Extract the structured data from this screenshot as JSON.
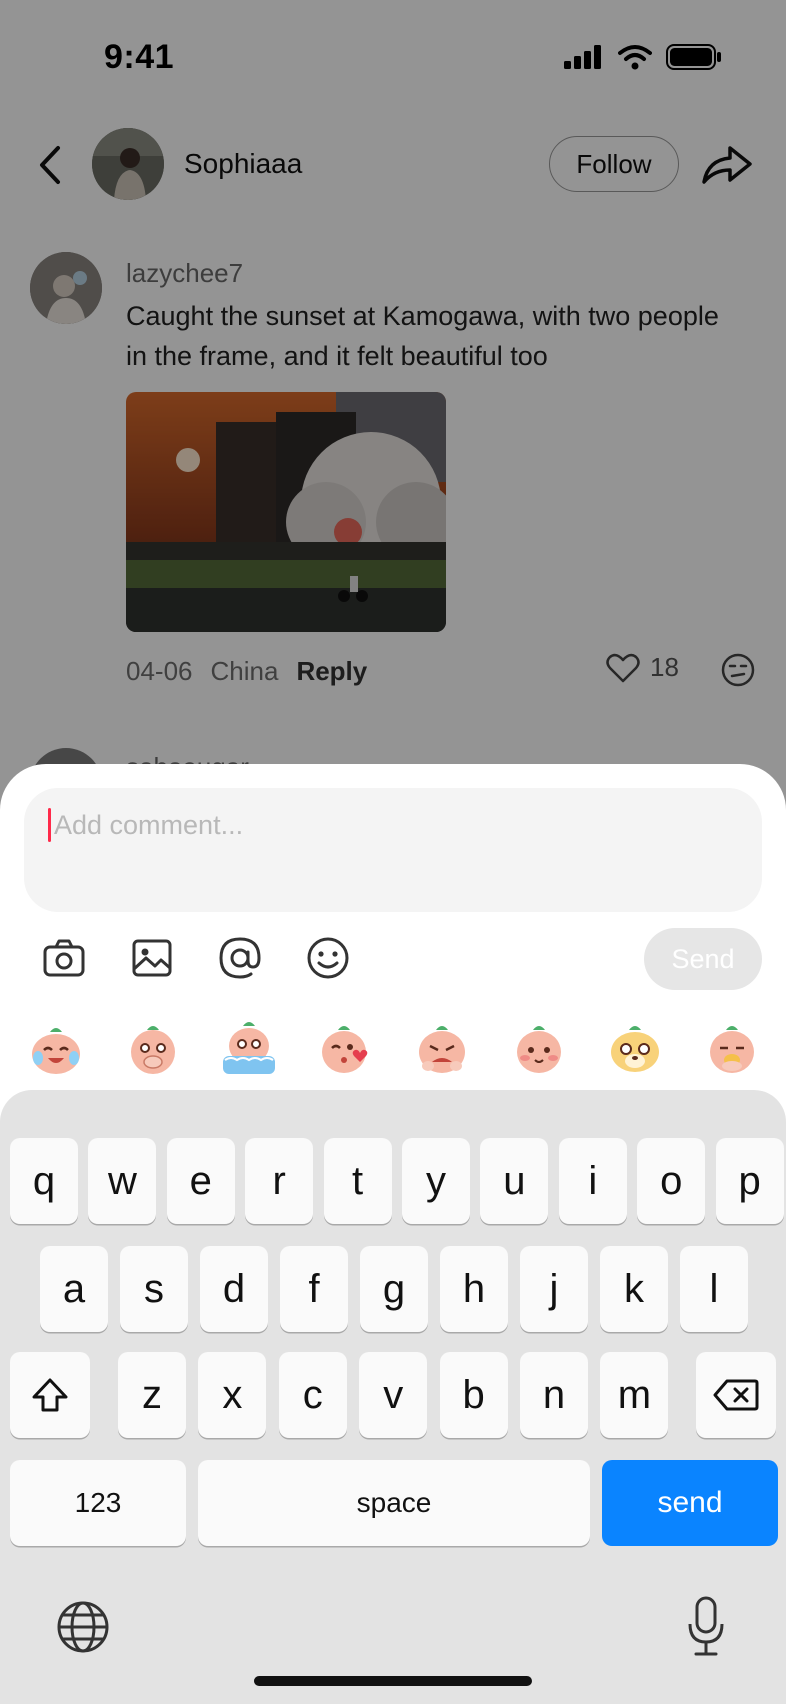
{
  "status_bar": {
    "time": "9:41"
  },
  "header": {
    "username": "Sophiaaa",
    "follow_label": "Follow"
  },
  "comment": {
    "username": "lazychee7",
    "text": "Caught the sunset at Kamogawa, with two people in the frame, and it felt beautiful too",
    "date": "04-06",
    "location": "China",
    "reply_label": "Reply",
    "like_count": "18"
  },
  "next_comment": {
    "username": "sohoeugar"
  },
  "composer": {
    "placeholder": "Add comment...",
    "send_label": "Send",
    "tools": [
      "camera-icon",
      "image-icon",
      "at-icon",
      "smile-icon"
    ],
    "stickers": [
      "laugh-cry",
      "hand-over-mouth",
      "crying-in-bath",
      "kiss-heart",
      "hug-face",
      "blush",
      "dog-face",
      "nose-pick"
    ]
  },
  "keyboard": {
    "row1": [
      "q",
      "w",
      "e",
      "r",
      "t",
      "y",
      "u",
      "i",
      "o",
      "p"
    ],
    "row2": [
      "a",
      "s",
      "d",
      "f",
      "g",
      "h",
      "j",
      "k",
      "l"
    ],
    "row3": [
      "z",
      "x",
      "c",
      "v",
      "b",
      "n",
      "m"
    ],
    "numbers_label": "123",
    "space_label": "space",
    "send_label": "send",
    "colors": {
      "send_key": "#0a84ff",
      "caret": "#ff2a4a"
    }
  }
}
